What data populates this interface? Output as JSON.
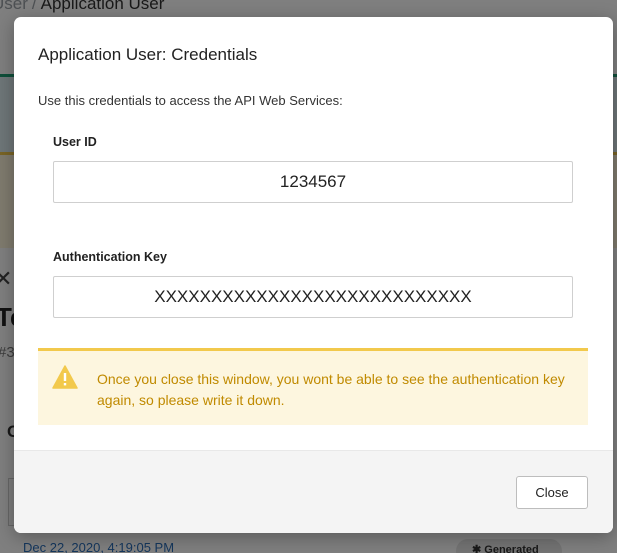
{
  "background": {
    "breadcrumb_prev": "User",
    "breadcrumb_separator": "/",
    "breadcrumb_current": "Application User",
    "title": "Te",
    "subtitle": "#3",
    "section": "C",
    "date_link": "Dec 22, 2020, 4:19:05 PM",
    "badge_label": "Generated",
    "badge_icon": "gear-icon"
  },
  "modal": {
    "title": "Application User: Credentials",
    "description": "Use this credentials to access the API Web Services:",
    "user_id": {
      "label": "User ID",
      "value": "1234567"
    },
    "auth_key": {
      "label": "Authentication Key",
      "value": "XXXXXXXXXXXXXXXXXXXXXXXXXXXX"
    },
    "warning": {
      "icon": "warning-triangle-icon",
      "text": "Once you close this window, you wont be able to see the authentication key again, so please write it down."
    },
    "close_label": "Close"
  },
  "colors": {
    "warning_text": "#c08a00",
    "warning_bg": "#fdf6df",
    "warning_border": "#f2c94c",
    "accent_green": "#1f9e74",
    "link_blue": "#2a6ebb"
  }
}
